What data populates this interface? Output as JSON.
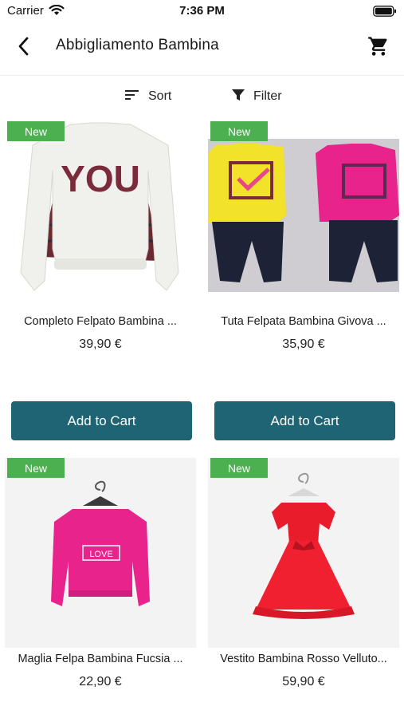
{
  "status_bar": {
    "carrier": "Carrier",
    "time": "7:36 PM"
  },
  "header": {
    "title": "Abbigliamento Bambina",
    "back_icon": "chevron-left-icon",
    "cart_icon": "shopping-cart-icon"
  },
  "toolbar": {
    "sort_label": "Sort",
    "filter_label": "Filter"
  },
  "colors": {
    "badge": "#4caf50",
    "button": "#1e6474"
  },
  "products": [
    {
      "badge": "New",
      "name": "Completo Felpato Bambina ...",
      "price": "39,90 €",
      "button": "Add to Cart"
    },
    {
      "badge": "New",
      "name": "Tuta Felpata Bambina Givova ...",
      "price": "35,90 €",
      "button": "Add to Cart"
    },
    {
      "badge": "New",
      "name": "Maglia Felpa Bambina Fucsia ...",
      "price": "22,90 €"
    },
    {
      "badge": "New",
      "name": "Vestito Bambina Rosso Velluto...",
      "price": "59,90 €"
    }
  ]
}
